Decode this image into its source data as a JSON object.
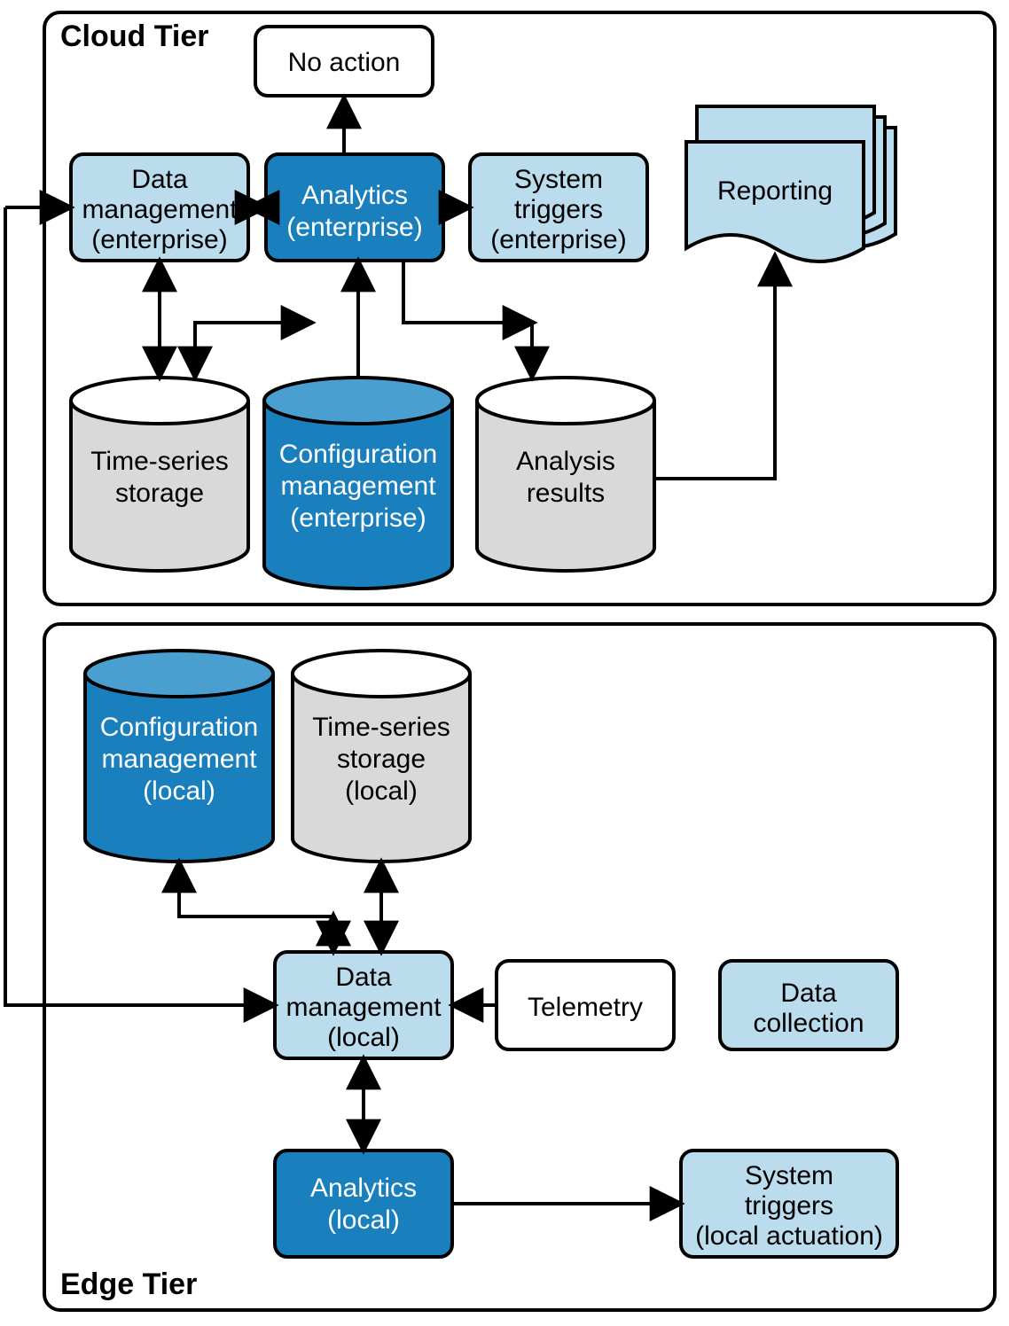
{
  "tiers": {
    "cloud": {
      "label": "Cloud Tier"
    },
    "edge": {
      "label": "Edge Tier"
    }
  },
  "nodes": {
    "no_action": {
      "l1": "No action"
    },
    "data_mgmt_ent": {
      "l1": "Data",
      "l2": "management",
      "l3": "(enterprise)"
    },
    "analytics_ent": {
      "l1": "Analytics",
      "l2": "(enterprise)"
    },
    "sys_trig_ent": {
      "l1": "System",
      "l2": "triggers",
      "l3": "(enterprise)"
    },
    "reporting": {
      "l1": "Reporting"
    },
    "ts_storage": {
      "l1": "Time-series",
      "l2": "storage"
    },
    "cfg_mgmt_ent": {
      "l1": "Configuration",
      "l2": "management",
      "l3": "(enterprise)"
    },
    "analysis_results": {
      "l1": "Analysis",
      "l2": "results"
    },
    "cfg_mgmt_local": {
      "l1": "Configuration",
      "l2": "management",
      "l3": "(local)"
    },
    "ts_storage_local": {
      "l1": "Time-series",
      "l2": "storage",
      "l3": "(local)"
    },
    "data_mgmt_local": {
      "l1": "Data",
      "l2": "management",
      "l3": "(local)"
    },
    "telemetry": {
      "l1": "Telemetry"
    },
    "data_collection": {
      "l1": "Data",
      "l2": "collection"
    },
    "analytics_local": {
      "l1": "Analytics",
      "l2": "(local)"
    },
    "sys_trig_local": {
      "l1": "System",
      "l2": "triggers",
      "l3": "(local actuation)"
    }
  },
  "colors": {
    "lightblue": "#bbdced",
    "darkblue": "#1a7fbd",
    "gray": "#d9d9d9",
    "stroke": "#000000"
  }
}
